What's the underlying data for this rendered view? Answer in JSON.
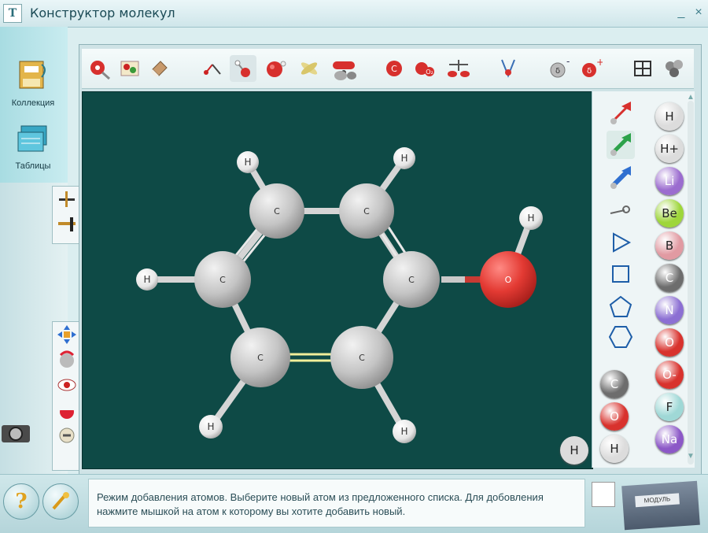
{
  "window": {
    "title": "Конструктор молекул",
    "title_icon_glyph": "Т",
    "minimize_glyph": "_",
    "close_glyph": "×"
  },
  "left_panel": {
    "items": [
      {
        "label": "Коллекция",
        "icon": "collection-icon"
      },
      {
        "label": "Таблицы",
        "icon": "tables-icon"
      }
    ]
  },
  "toolbar": {
    "tools": [
      "select-tool-icon",
      "clear-tool-icon",
      "eraser-tool-icon",
      "bond-angle-icon",
      "single-bond-icon",
      "atom-sphere-icon",
      "rotate-tool-icon",
      "orbital-icon",
      "electron-cloud-icon",
      "carbon-atom-icon",
      "ozone-icon",
      "balance-icon",
      "beaker-icon",
      "charge-minus-icon",
      "charge-plus-icon",
      "lattice-icon",
      "molecule-3d-icon"
    ]
  },
  "molecule": {
    "atom_labels": {
      "carbon": "C",
      "hydrogen": "H",
      "oxygen": "O"
    },
    "colors": {
      "carbon": "#c9c9c9",
      "hydrogen": "#f4f4f4",
      "oxygen": "#e23a34",
      "bond": "#d9d9d9",
      "canvas": "#0e4a46"
    }
  },
  "atom_palette": [
    {
      "symbol": "H",
      "color": "#dcdcdc",
      "text": "#222"
    },
    {
      "symbol": "H+",
      "color": "#dcdcdc",
      "text": "#222"
    },
    {
      "symbol": "Li",
      "color": "#9b6ccf",
      "text": "#fff"
    },
    {
      "symbol": "Be",
      "color": "#9ed63a",
      "text": "#222"
    },
    {
      "symbol": "B",
      "color": "#e19aa2",
      "text": "#222"
    },
    {
      "symbol": "C",
      "color": "#6d6d6d",
      "text": "#fff"
    },
    {
      "symbol": "N",
      "color": "#8c6fd3",
      "text": "#fff"
    },
    {
      "symbol": "O",
      "color": "#d8322d",
      "text": "#fff"
    },
    {
      "symbol": "O-",
      "color": "#d8322d",
      "text": "#fff"
    },
    {
      "symbol": "F",
      "color": "#9fd8d6",
      "text": "#222"
    },
    {
      "symbol": "Na",
      "color": "#8c58c7",
      "text": "#fff"
    }
  ],
  "recent_atoms": [
    {
      "symbol": "C",
      "color": "#6d6d6d",
      "text": "#fff"
    },
    {
      "symbol": "O",
      "color": "#d8322d",
      "text": "#fff"
    },
    {
      "symbol": "H",
      "color": "#dcdcdc",
      "text": "#222"
    }
  ],
  "selected_atom": {
    "symbol": "H"
  },
  "status": {
    "message": "Режим добавления атомов. Выберите новый атом из предложенного списка. Для добовления нажмите мышкой на атом к которому вы хотите добавить новый."
  },
  "bottom": {
    "help_glyph": "?",
    "book_label": "МОДУЛЬ"
  }
}
